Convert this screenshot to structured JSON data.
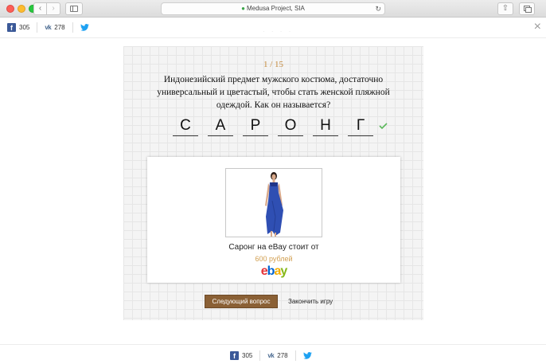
{
  "browser": {
    "address": "Medusa Project, SIA",
    "back_glyph": "‹",
    "forward_glyph": "›",
    "reload_glyph": "↻",
    "share_glyph": "⇧"
  },
  "share_top": {
    "facebook_count": "305",
    "vk_count": "278"
  },
  "share_bottom": {
    "facebook_count": "305",
    "vk_count": "278"
  },
  "close_glyph": "×",
  "quiz": {
    "counter": "1 / 15",
    "question": "Индонезийский предмет мужского костюма, достаточно универсальный и цветастый, чтобы стать женской пляжной одеждой. Как он называется?",
    "answer_letters": [
      "С",
      "А",
      "Р",
      "О",
      "Н",
      "Г"
    ],
    "result": {
      "text": "Саронг на eBay стоит от",
      "price": "600 рублей",
      "logo": {
        "e": "e",
        "b": "b",
        "a": "a",
        "y": "y"
      }
    },
    "next_button": "Следующий вопрос",
    "finish_link": "Закончить игру"
  },
  "colors": {
    "accent": "#c4893c",
    "button": "#8a6035",
    "check": "#5cb85c",
    "facebook": "#3b5998",
    "vk": "#4a6a91",
    "twitter": "#1da1f2"
  }
}
